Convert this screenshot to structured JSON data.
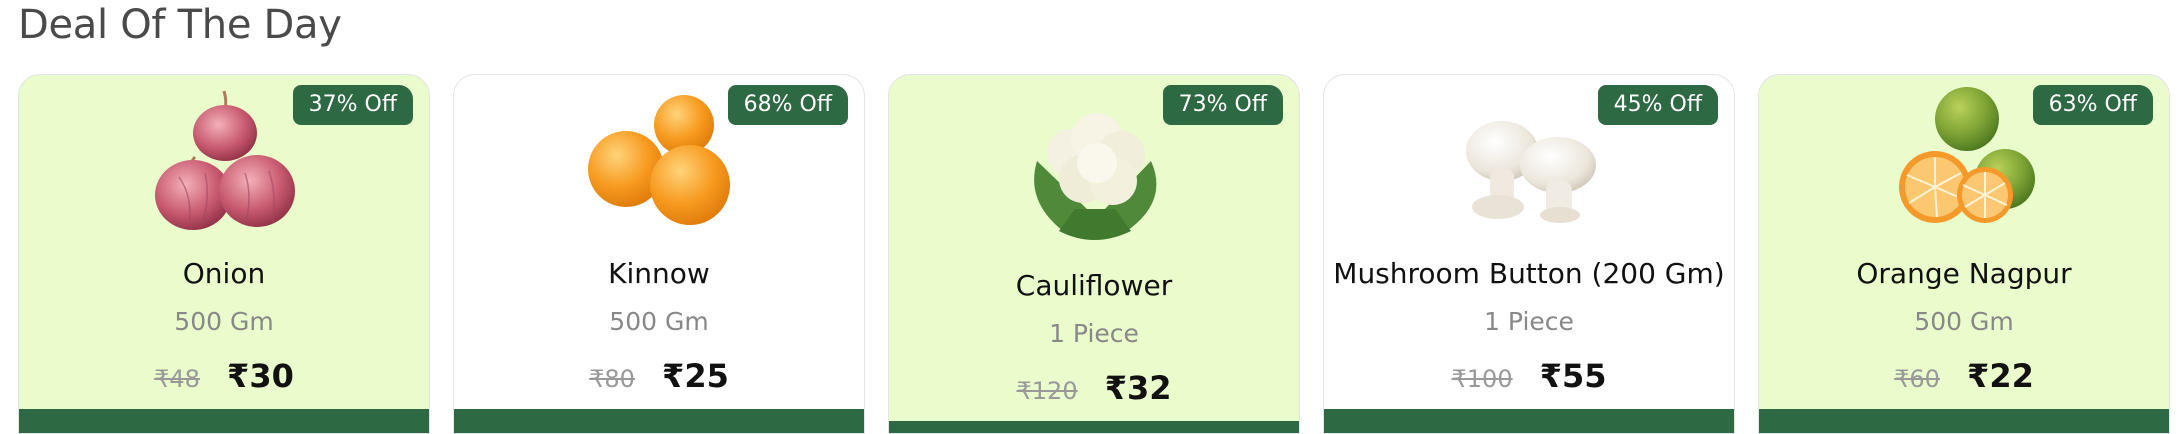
{
  "section": {
    "title": "Deal Of The Day"
  },
  "theme": {
    "green_bg": "#eafccc",
    "badge_color": "#2d6a43"
  },
  "products": [
    {
      "name": "Onion",
      "quantity": "500 Gm",
      "old_price": "₹48",
      "new_price": "₹30",
      "discount": "37% Off",
      "icon": "onion-image"
    },
    {
      "name": "Kinnow",
      "quantity": "500 Gm",
      "old_price": "₹80",
      "new_price": "₹25",
      "discount": "68% Off",
      "icon": "kinnow-image"
    },
    {
      "name": "Cauliflower",
      "quantity": "1 Piece",
      "old_price": "₹120",
      "new_price": "₹32",
      "discount": "73% Off",
      "icon": "cauliflower-image"
    },
    {
      "name": "Mushroom Button (200 Gm)",
      "quantity": "1 Piece",
      "old_price": "₹100",
      "new_price": "₹55",
      "discount": "45% Off",
      "icon": "mushroom-image"
    },
    {
      "name": "Orange Nagpur",
      "quantity": "500 Gm",
      "old_price": "₹60",
      "new_price": "₹22",
      "discount": "63% Off",
      "icon": "orange-image"
    }
  ]
}
